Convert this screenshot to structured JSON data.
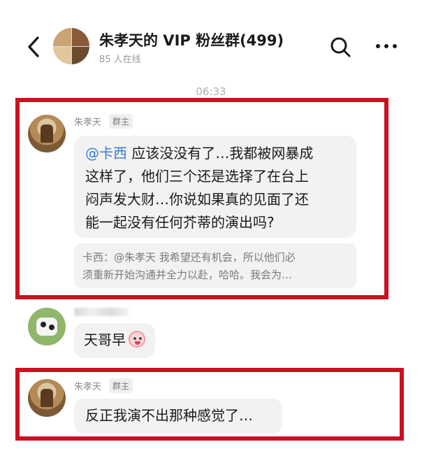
{
  "header": {
    "title": "朱孝天的 VIP 粉丝群(499)",
    "online_count": "85 人在线",
    "back_icon": "chevron-left-icon",
    "search_icon": "search-icon",
    "more_icon": "more-horizontal-icon"
  },
  "timestamp": "06:33",
  "messages": [
    {
      "sender": "朱孝天",
      "role_badge": "群主",
      "mention": "@卡西",
      "line1_rest": " 应该没没有了…我都被网暴成",
      "line2": "这样了，他们三个还是选择了在台上",
      "line3": "闷声发大财…你说如果真的见面了还",
      "line4": "能一起没有任何芥蒂的演出吗?",
      "quote_line1": "卡西：@朱孝天 我希望还有机会，所以他们必",
      "quote_line2": "须重新开始沟通并全力以赴，哈哈。我会为…"
    },
    {
      "sender": "",
      "text": "天哥早",
      "emoji": "crying-laughing-emoji"
    },
    {
      "sender": "朱孝天",
      "role_badge": "群主",
      "text": "反正我演不出那种感觉了…"
    }
  ],
  "colors": {
    "highlight_frame": "#cc1020",
    "mention": "#3a7bd5",
    "bubble_bg": "#f2f2f2"
  }
}
